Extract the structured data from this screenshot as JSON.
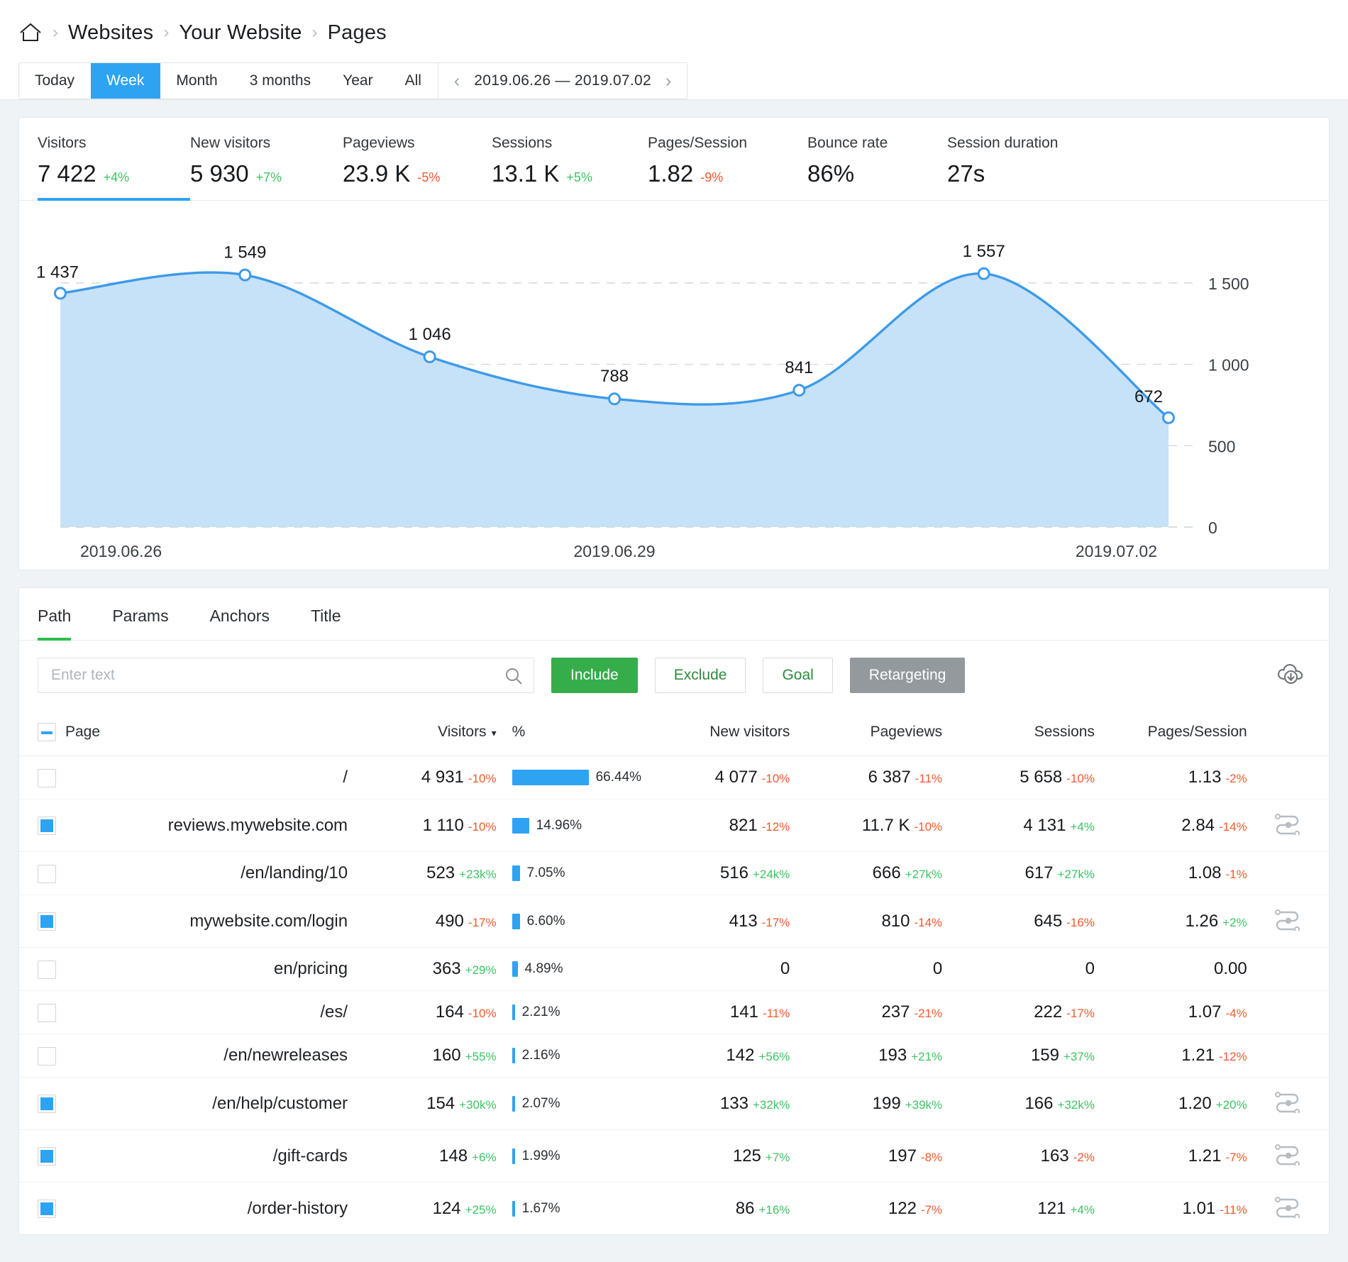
{
  "breadcrumb": {
    "home_icon": "home-icon",
    "items": [
      "Websites",
      "Your Website",
      "Pages"
    ],
    "separator": "›"
  },
  "range_bar": {
    "periods": [
      "Today",
      "Week",
      "Month",
      "3 months",
      "Year",
      "All"
    ],
    "active_period": "Week",
    "date_range": "2019.06.26 — 2019.07.02",
    "prev_arrow": "‹",
    "next_arrow": "›"
  },
  "metrics": [
    {
      "label": "Visitors",
      "value": "7 422",
      "delta": "+4%",
      "dir": "pos",
      "active": true
    },
    {
      "label": "New visitors",
      "value": "5 930",
      "delta": "+7%",
      "dir": "pos",
      "active": false
    },
    {
      "label": "Pageviews",
      "value": "23.9 K",
      "delta": "-5%",
      "dir": "neg",
      "active": false
    },
    {
      "label": "Sessions",
      "value": "13.1 K",
      "delta": "+5%",
      "dir": "pos",
      "active": false
    },
    {
      "label": "Pages/Session",
      "value": "1.82",
      "delta": "-9%",
      "dir": "neg",
      "active": false
    },
    {
      "label": "Bounce rate",
      "value": "86%",
      "delta": "",
      "dir": "",
      "active": false
    },
    {
      "label": "Session duration",
      "value": "27s",
      "delta": "",
      "dir": "",
      "active": false
    }
  ],
  "chart_data": {
    "type": "area",
    "title": "Visitors",
    "xlabel": "",
    "ylabel": "",
    "x": [
      "2019.06.26",
      "2019.06.27",
      "2019.06.28",
      "2019.06.29",
      "2019.06.30",
      "2019.07.01",
      "2019.07.02"
    ],
    "values": [
      1437,
      1549,
      1046,
      788,
      841,
      1557,
      672
    ],
    "point_labels": [
      "1 437",
      "1 549",
      "1 046",
      "788",
      "841",
      "1 557",
      "672"
    ],
    "x_tick_labels": [
      "2019.06.26",
      "2019.06.29",
      "2019.07.02"
    ],
    "y_tick_labels": [
      "0",
      "500",
      "1 000",
      "1 500"
    ],
    "y_ticks": [
      0,
      500,
      1000,
      1500
    ],
    "ylim": [
      0,
      1700
    ],
    "grid": true,
    "legend": "none",
    "line_color": "#3d9ae8",
    "fill_color": "#c6e2f8"
  },
  "table_tabs": {
    "items": [
      "Path",
      "Params",
      "Anchors",
      "Title"
    ],
    "active": "Path"
  },
  "filter": {
    "placeholder": "Enter text",
    "value": "",
    "search_icon": "search-icon",
    "download_icon": "download-cloud-icon",
    "buttons": [
      {
        "label": "Include",
        "style": "include"
      },
      {
        "label": "Exclude",
        "style": "exclude"
      },
      {
        "label": "Goal",
        "style": "goal"
      },
      {
        "label": "Retargeting",
        "style": "retarget"
      }
    ]
  },
  "table": {
    "columns": [
      "Page",
      "Visitors",
      "%",
      "New visitors",
      "Pageviews",
      "Sessions",
      "Pages/Session"
    ],
    "sorted_by": "Visitors",
    "sort_caret": "▾",
    "header_checkbox": "dash",
    "rows": [
      {
        "checkbox": "empty",
        "page": "/",
        "visitors": "4 931",
        "visitors_delta": "-10%",
        "visitors_dir": "neg",
        "pct": "66.44%",
        "pct_value": 66.44,
        "new_visitors": "4 077",
        "new_visitors_delta": "-10%",
        "new_visitors_dir": "neg",
        "pageviews": "6 387",
        "pageviews_delta": "-11%",
        "pageviews_dir": "neg",
        "sessions": "5 658",
        "sessions_delta": "-10%",
        "sessions_dir": "neg",
        "pps": "1.13",
        "pps_delta": "-2%",
        "pps_dir": "neg",
        "journey": false
      },
      {
        "checkbox": "filled",
        "page": "reviews.mywebsite.com",
        "visitors": "1 110",
        "visitors_delta": "-10%",
        "visitors_dir": "neg",
        "pct": "14.96%",
        "pct_value": 14.96,
        "new_visitors": "821",
        "new_visitors_delta": "-12%",
        "new_visitors_dir": "neg",
        "pageviews": "11.7 K",
        "pageviews_delta": "-10%",
        "pageviews_dir": "neg",
        "sessions": "4 131",
        "sessions_delta": "+4%",
        "sessions_dir": "pos",
        "pps": "2.84",
        "pps_delta": "-14%",
        "pps_dir": "neg",
        "journey": true
      },
      {
        "checkbox": "empty",
        "page": "/en/landing/10",
        "visitors": "523",
        "visitors_delta": "+23k%",
        "visitors_dir": "pos",
        "pct": "7.05%",
        "pct_value": 7.05,
        "new_visitors": "516",
        "new_visitors_delta": "+24k%",
        "new_visitors_dir": "pos",
        "pageviews": "666",
        "pageviews_delta": "+27k%",
        "pageviews_dir": "pos",
        "sessions": "617",
        "sessions_delta": "+27k%",
        "sessions_dir": "pos",
        "pps": "1.08",
        "pps_delta": "-1%",
        "pps_dir": "neg",
        "journey": false
      },
      {
        "checkbox": "filled",
        "page": "mywebsite.com/login",
        "visitors": "490",
        "visitors_delta": "-17%",
        "visitors_dir": "neg",
        "pct": "6.60%",
        "pct_value": 6.6,
        "new_visitors": "413",
        "new_visitors_delta": "-17%",
        "new_visitors_dir": "neg",
        "pageviews": "810",
        "pageviews_delta": "-14%",
        "pageviews_dir": "neg",
        "sessions": "645",
        "sessions_delta": "-16%",
        "sessions_dir": "neg",
        "pps": "1.26",
        "pps_delta": "+2%",
        "pps_dir": "pos",
        "journey": true
      },
      {
        "checkbox": "empty",
        "page": "en/pricing",
        "visitors": "363",
        "visitors_delta": "+29%",
        "visitors_dir": "pos",
        "pct": "4.89%",
        "pct_value": 4.89,
        "new_visitors": "0",
        "new_visitors_delta": "",
        "new_visitors_dir": "",
        "pageviews": "0",
        "pageviews_delta": "",
        "pageviews_dir": "",
        "sessions": "0",
        "sessions_delta": "",
        "sessions_dir": "",
        "pps": "0.00",
        "pps_delta": "",
        "pps_dir": "",
        "journey": false
      },
      {
        "checkbox": "empty",
        "page": "/es/",
        "visitors": "164",
        "visitors_delta": "-10%",
        "visitors_dir": "neg",
        "pct": "2.21%",
        "pct_value": 2.21,
        "new_visitors": "141",
        "new_visitors_delta": "-11%",
        "new_visitors_dir": "neg",
        "pageviews": "237",
        "pageviews_delta": "-21%",
        "pageviews_dir": "neg",
        "sessions": "222",
        "sessions_delta": "-17%",
        "sessions_dir": "neg",
        "pps": "1.07",
        "pps_delta": "-4%",
        "pps_dir": "neg",
        "journey": false
      },
      {
        "checkbox": "empty",
        "page": "/en/newreleases",
        "visitors": "160",
        "visitors_delta": "+55%",
        "visitors_dir": "pos",
        "pct": "2.16%",
        "pct_value": 2.16,
        "new_visitors": "142",
        "new_visitors_delta": "+56%",
        "new_visitors_dir": "pos",
        "pageviews": "193",
        "pageviews_delta": "+21%",
        "pageviews_dir": "pos",
        "sessions": "159",
        "sessions_delta": "+37%",
        "sessions_dir": "pos",
        "pps": "1.21",
        "pps_delta": "-12%",
        "pps_dir": "neg",
        "journey": false
      },
      {
        "checkbox": "filled",
        "page": "/en/help/customer",
        "visitors": "154",
        "visitors_delta": "+30k%",
        "visitors_dir": "pos",
        "pct": "2.07%",
        "pct_value": 2.07,
        "new_visitors": "133",
        "new_visitors_delta": "+32k%",
        "new_visitors_dir": "pos",
        "pageviews": "199",
        "pageviews_delta": "+39k%",
        "pageviews_dir": "pos",
        "sessions": "166",
        "sessions_delta": "+32k%",
        "sessions_dir": "pos",
        "pps": "1.20",
        "pps_delta": "+20%",
        "pps_dir": "pos",
        "journey": true
      },
      {
        "checkbox": "filled",
        "page": "/gift-cards",
        "visitors": "148",
        "visitors_delta": "+6%",
        "visitors_dir": "pos",
        "pct": "1.99%",
        "pct_value": 1.99,
        "new_visitors": "125",
        "new_visitors_delta": "+7%",
        "new_visitors_dir": "pos",
        "pageviews": "197",
        "pageviews_delta": "-8%",
        "pageviews_dir": "neg",
        "sessions": "163",
        "sessions_delta": "-2%",
        "sessions_dir": "neg",
        "pps": "1.21",
        "pps_delta": "-7%",
        "pps_dir": "neg",
        "journey": true
      },
      {
        "checkbox": "filled",
        "page": "/order-history",
        "visitors": "124",
        "visitors_delta": "+25%",
        "visitors_dir": "pos",
        "pct": "1.67%",
        "pct_value": 1.67,
        "new_visitors": "86",
        "new_visitors_delta": "+16%",
        "new_visitors_dir": "pos",
        "pageviews": "122",
        "pageviews_delta": "-7%",
        "pageviews_dir": "neg",
        "sessions": "121",
        "sessions_delta": "+4%",
        "sessions_dir": "pos",
        "pps": "1.01",
        "pps_delta": "-11%",
        "pps_dir": "neg",
        "journey": true
      }
    ]
  },
  "colors": {
    "accent_blue": "#2ea3f2",
    "chart_line": "#3d9ae8",
    "chart_fill": "#c6e2f8",
    "green": "#3bc463",
    "red": "#f4582e",
    "tab_underline_green": "#2bbd4e",
    "include_green": "#36ad4b",
    "retarget_gray": "#93999d"
  }
}
